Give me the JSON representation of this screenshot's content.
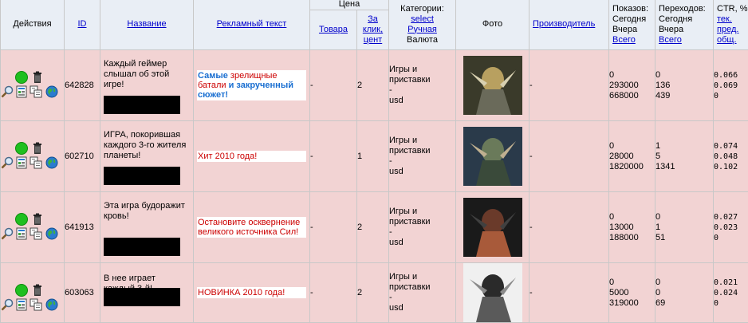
{
  "header": {
    "actions": "Действия",
    "id": "ID",
    "title": "Название",
    "ad_text": "Рекламный текст",
    "price": "Цена",
    "price_goods": "Товара",
    "price_click": "За клик, цент",
    "categories_label": "Категории:",
    "select_link": "select",
    "manual_link": "Ручная",
    "currency": "Валюта",
    "photo": "Фото",
    "maker": "Производитель",
    "impressions_label": "Показов:",
    "today": "Сегодня",
    "yesterday": "Вчера",
    "total": "Всего",
    "clicks_label": "Переходов:",
    "clicks_today": "Сегодня",
    "clicks_yesterday": "Вчера",
    "clicks_total": "Всего",
    "ctr_label": "CTR, %",
    "ctr_cur": "тек.",
    "ctr_prev": "пред.",
    "ctr_total": "общ."
  },
  "rows": [
    {
      "id": "642828",
      "title": "Каждый геймер слышал об этой игре!",
      "ad_parts": [
        "Самые",
        " зрелищные батали ",
        "и закрученный сюжет!"
      ],
      "price_goods": "-",
      "price_click": "2",
      "category": "Игры и приставки",
      "dash": "-",
      "currency": "usd",
      "maker": "-",
      "impressions": [
        "0",
        "293000",
        "668000"
      ],
      "clicks": [
        "0",
        "136",
        "439"
      ],
      "ctr": [
        "0.066",
        "0.069",
        "0"
      ]
    },
    {
      "id": "602710",
      "title": "ИГРА, покорившая каждого 3-го жителя планеты!",
      "ad_text": "Хит 2010 года!",
      "price_goods": "-",
      "price_click": "1",
      "category": "Игры и приставки",
      "dash": "-",
      "currency": "usd",
      "maker": "-",
      "impressions": [
        "0",
        "28000",
        "1820000"
      ],
      "clicks": [
        "1",
        "5",
        "1341"
      ],
      "ctr": [
        "0.074",
        "0.048",
        "0.102"
      ]
    },
    {
      "id": "641913",
      "title": "Эта игра будоражит кровь!",
      "ad_text": "Остановите осквернение великого источника Сил!",
      "price_goods": "-",
      "price_click": "2",
      "category": "Игры и приставки",
      "dash": "-",
      "currency": "usd",
      "maker": "-",
      "impressions": [
        "0",
        "13000",
        "188000"
      ],
      "clicks": [
        "0",
        "1",
        "51"
      ],
      "ctr": [
        "0.027",
        "0.023",
        "0"
      ]
    },
    {
      "id": "603063",
      "title": "В нее играет каждый 3-й!",
      "ad_text": "НОВИНКА 2010 года!",
      "price_goods": "-",
      "price_click": "2",
      "category": "Игры и приставки",
      "dash": "-",
      "currency": "usd",
      "maker": "-",
      "impressions": [
        "0",
        "5000",
        "319000"
      ],
      "clicks": [
        "0",
        "0",
        "69"
      ],
      "ctr": [
        "0.021",
        "0.024",
        "0"
      ]
    }
  ],
  "icons": {
    "status": "green-circle-icon",
    "delete": "trash-icon",
    "search": "magnifier-icon",
    "stats": "report-icon",
    "copy": "copy-icon",
    "globe": "globe-icon",
    "archive": "archive-icon"
  },
  "colors": {
    "row_bg": "#f2d3d3",
    "header_bg": "#e9eef5",
    "link": "#0000cc",
    "ad_red": "#cc0000",
    "ad_blue": "#1a6fd1"
  }
}
